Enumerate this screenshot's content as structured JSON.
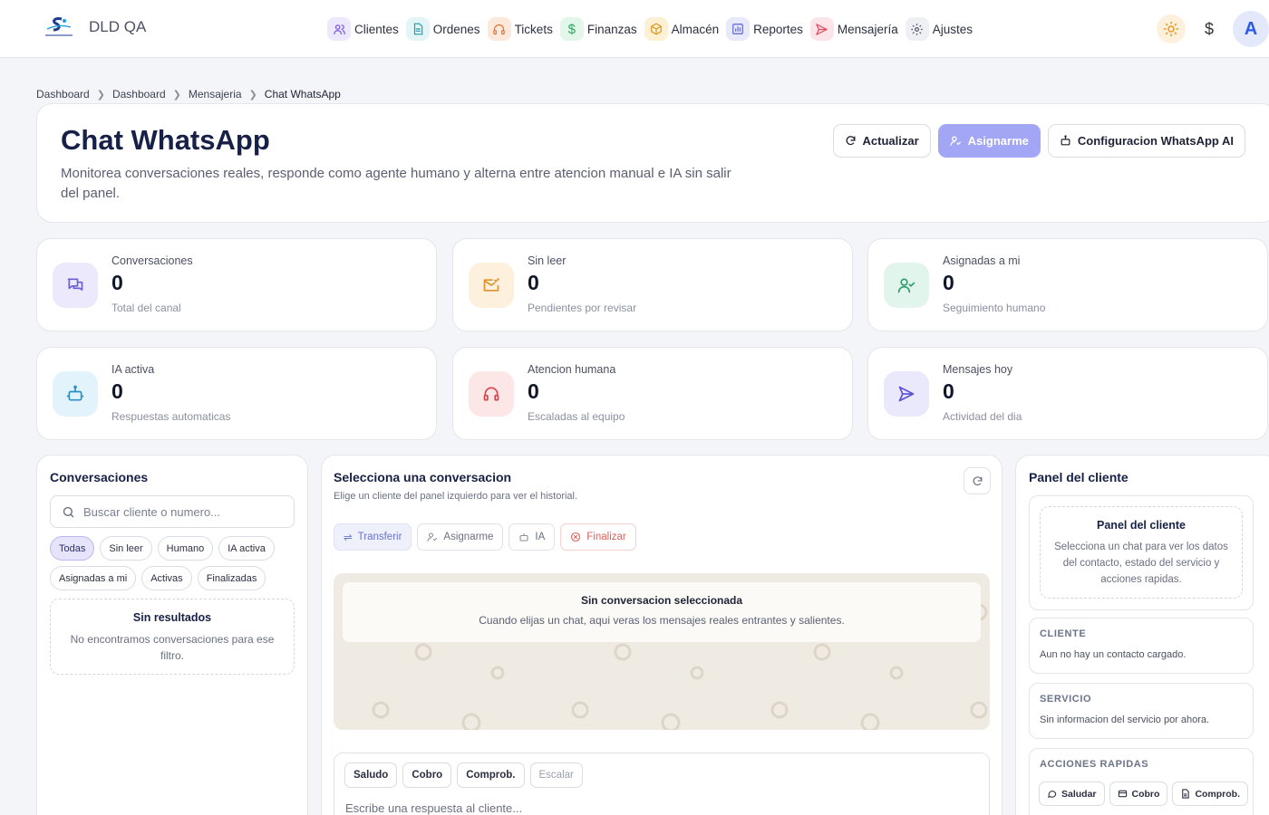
{
  "app": {
    "title": "DLD QA",
    "logo_text": "SKYLINK"
  },
  "nav": [
    {
      "label": "Clientes",
      "icon": "users-icon",
      "bg": "#ede8fb",
      "color": "#7b5ce0"
    },
    {
      "label": "Ordenes",
      "icon": "document-icon",
      "bg": "#e3f5f7",
      "color": "#1f9bb0"
    },
    {
      "label": "Tickets",
      "icon": "headset-icon",
      "bg": "#fde8dc",
      "color": "#e07a3a"
    },
    {
      "label": "Finanzas",
      "icon": "dollar-icon",
      "bg": "#e2f6e9",
      "color": "#2ea660"
    },
    {
      "label": "Almacén",
      "icon": "box-icon",
      "bg": "#fdf0d3",
      "color": "#d9951e"
    },
    {
      "label": "Reportes",
      "icon": "chart-icon",
      "bg": "#e8e9fb",
      "color": "#5a63d8"
    },
    {
      "label": "Mensajería",
      "icon": "send-icon",
      "bg": "#fde4e8",
      "color": "#e0485e"
    },
    {
      "label": "Ajustes",
      "icon": "gear-icon",
      "bg": "#eef0f3",
      "color": "#555c6b"
    }
  ],
  "topbar": {
    "currency_symbol": "$",
    "avatar_initial": "A"
  },
  "breadcrumb": [
    "Dashboard",
    "Dashboard",
    "Mensajeria",
    "Chat WhatsApp"
  ],
  "header": {
    "title": "Chat WhatsApp",
    "description": "Monitorea conversaciones reales, responde como agente humano y alterna entre atencion manual e IA sin salir del panel.",
    "buttons": {
      "refresh": "Actualizar",
      "assign": "Asignarme",
      "config": "Configuracion WhatsApp AI"
    }
  },
  "stats": [
    {
      "label": "Conversaciones",
      "value": "0",
      "sub": "Total del canal",
      "icon": "chat-bubbles-icon",
      "bg": "#ebe9fb",
      "color": "#6a5fd9"
    },
    {
      "label": "Sin leer",
      "value": "0",
      "sub": "Pendientes por revisar",
      "icon": "mail-check-icon",
      "bg": "#fdf0dc",
      "color": "#e0932a"
    },
    {
      "label": "Asignadas a mi",
      "value": "0",
      "sub": "Seguimiento humano",
      "icon": "user-check-icon",
      "bg": "#e2f5ec",
      "color": "#2e9e6c"
    },
    {
      "label": "IA activa",
      "value": "0",
      "sub": "Respuestas automaticas",
      "icon": "bot-icon",
      "bg": "#e3f3fb",
      "color": "#2a8fc8"
    },
    {
      "label": "Atencion humana",
      "value": "0",
      "sub": "Escaladas al equipo",
      "icon": "headset-icon",
      "bg": "#fde6e6",
      "color": "#d8434a"
    },
    {
      "label": "Mensajes hoy",
      "value": "0",
      "sub": "Actividad del dia",
      "icon": "send-icon",
      "bg": "#eae8fb",
      "color": "#5b50d6"
    }
  ],
  "conversations": {
    "title": "Conversaciones",
    "search_placeholder": "Buscar cliente o numero...",
    "filters": [
      "Todas",
      "Sin leer",
      "Humano",
      "IA activa",
      "Asignadas a mi",
      "Activas",
      "Finalizadas"
    ],
    "active_filter": "Todas",
    "empty_title": "Sin resultados",
    "empty_text": "No encontramos conversaciones para ese filtro."
  },
  "chat": {
    "title": "Selecciona una conversacion",
    "subtitle": "Elige un cliente del panel izquierdo para ver el historial.",
    "actions": {
      "transfer": "Transferir",
      "assign": "Asignarme",
      "ai": "IA",
      "finish": "Finalizar"
    },
    "notice_title": "Sin conversacion seleccionada",
    "notice_text": "Cuando elijas un chat, aqui veras los mensajes reales entrantes y salientes.",
    "quick_replies": [
      "Saludo",
      "Cobro",
      "Comprob.",
      "Escalar"
    ],
    "input_placeholder": "Escribe una respuesta al cliente..."
  },
  "client_panel": {
    "title": "Panel del cliente",
    "box_title": "Panel del cliente",
    "box_text": "Selecciona un chat para ver los datos del contacto, estado del servicio y acciones rapidas.",
    "cliente_head": "CLIENTE",
    "cliente_text": "Aun no hay un contacto cargado.",
    "servicio_head": "SERVICIO",
    "servicio_text": "Sin informacion del servicio por ahora.",
    "acciones_head": "ACCIONES RAPIDAS",
    "acciones": [
      "Saludar",
      "Cobro",
      "Comprob."
    ]
  }
}
